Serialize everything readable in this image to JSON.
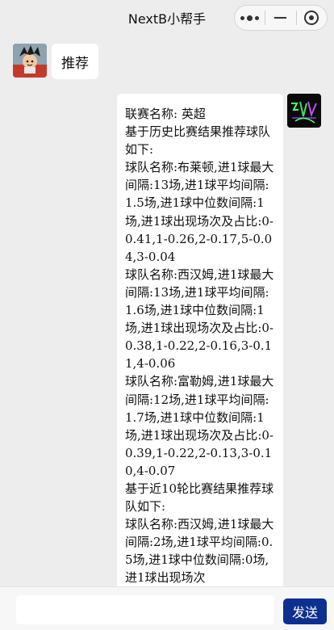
{
  "window": {
    "title": "NextB小帮手",
    "capsule_icons": [
      "more-dots-icon",
      "minimize-icon",
      "close-circle-icon"
    ]
  },
  "messages": [
    {
      "side": "left",
      "avatar": "cartoon-boy-avatar",
      "text": "推荐"
    },
    {
      "side": "right",
      "avatar": "neon-logo-avatar",
      "text": "联赛名称: 英超\n基于历史比赛结果推荐球队如下:\n球队名称:布莱顿,进1球最大间隔:13场,进1球平均间隔:1.5场,进1球中位数间隔:1场,进1球出现场次及占比:0-0.41,1-0.26,2-0.17,5-0.04,3-0.04\n球队名称:西汉姆,进1球最大间隔:13场,进1球平均间隔:1.6场,进1球中位数间隔:1场,进1球出现场次及占比:0-0.38,1-0.22,2-0.16,3-0.11,4-0.06\n球队名称:富勒姆,进1球最大间隔:12场,进1球平均间隔:1.7场,进1球中位数间隔:1场,进1球出现场次及占比:0-0.39,1-0.22,2-0.13,3-0.10,4-0.07\n基于近10轮比赛结果推荐球队如下:\n球队名称:西汉姆,进1球最大间隔:2场,进1球平均间隔:0.5场,进1球中位数间隔:0场,进1球出现场次"
    }
  ],
  "composer": {
    "input_value": "",
    "input_placeholder": "",
    "send_label": "发送"
  },
  "colors": {
    "background": "#ededed",
    "bubble": "#ffffff",
    "send_button": "#0d2f8f"
  }
}
